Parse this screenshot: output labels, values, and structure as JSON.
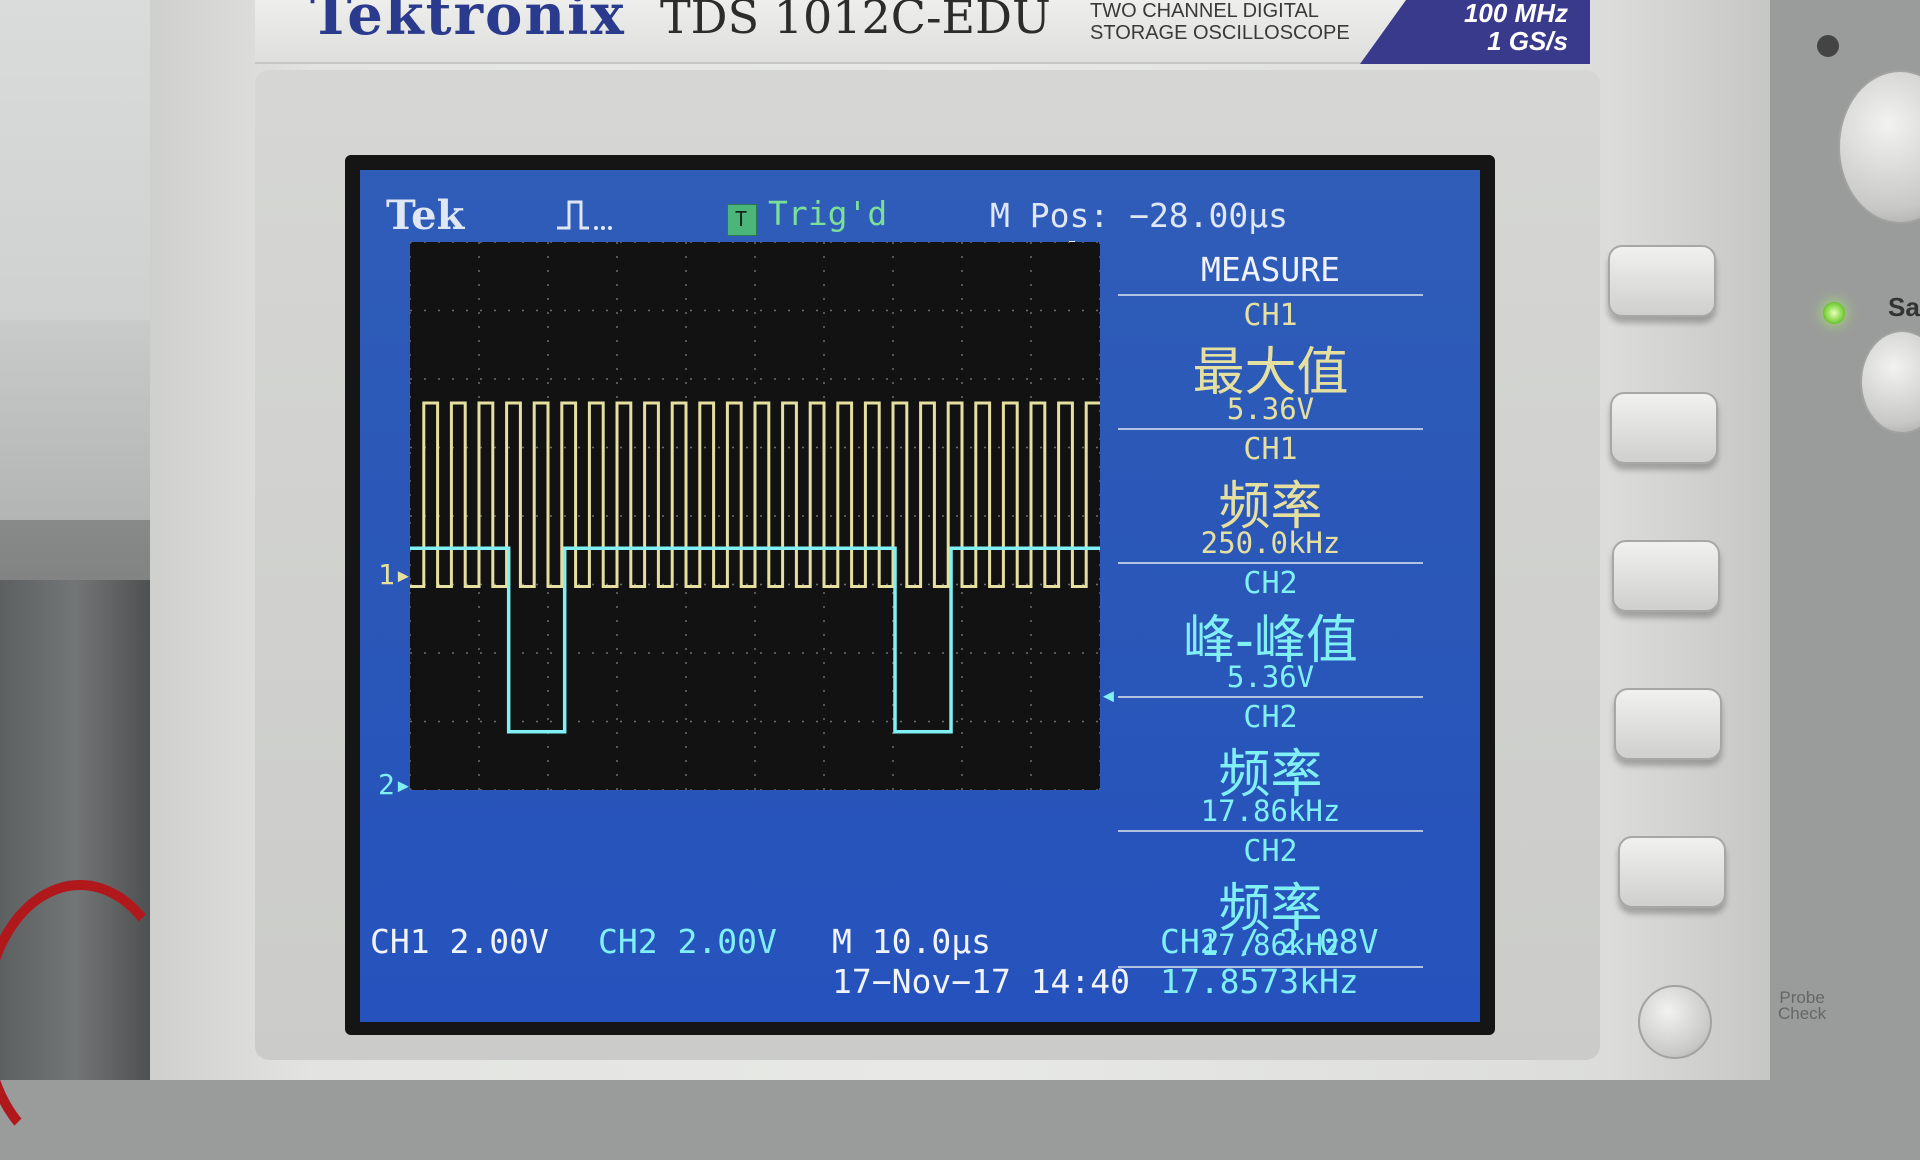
{
  "device": {
    "brand": "Tektronix",
    "model": "TDS 1012C-EDU",
    "description": "TWO CHANNEL DIGITAL\nSTORAGE OSCILLOSCOPE",
    "bandwidth": "100 MHz",
    "sample_rate": "1 GS/s",
    "side_label": "Sa",
    "probe_check_label": "Probe\nCheck"
  },
  "screen": {
    "logo": "Tek",
    "trigger_status": "Trig'd",
    "m_pos": "M Pos: −28.00µs",
    "ch1_marker": "1",
    "ch2_marker": "2",
    "menu": {
      "title": "MEASURE",
      "items": [
        {
          "channel": "CH1",
          "name": "最大值",
          "value": "5.36V"
        },
        {
          "channel": "CH1",
          "name": "频率",
          "value": "250.0kHz"
        },
        {
          "channel": "CH2",
          "name": "峰-峰值",
          "value": "5.36V"
        },
        {
          "channel": "CH2",
          "name": "频率",
          "value": "17.86kHz"
        },
        {
          "channel": "CH2",
          "name": "频率",
          "value": "17.86kHz"
        }
      ]
    },
    "status": {
      "ch1_scale": "CH1  2.00V",
      "ch2_scale": "CH2  2.00V",
      "timebase": "M 10.0µs",
      "datetime": "17−Nov−17 14:40",
      "trigger": "CH2 ∕ 2.08V",
      "trigger_freq": "17.8573kHz"
    },
    "colors": {
      "screen_bg": "#2a57b8",
      "ch1": "#e6e0a0",
      "ch2": "#80f0f5",
      "grid_bg": "#121212"
    }
  },
  "waveforms": {
    "ch1": {
      "type": "square",
      "frequency_khz": 250.0,
      "vmax_v": 5.36,
      "volts_per_div": 2.0
    },
    "ch2": {
      "type": "pulse",
      "frequency_khz": 17.86,
      "vpp_v": 5.36,
      "volts_per_div": 2.0,
      "trigger_level_v": 2.08
    },
    "timebase_us_per_div": 10.0,
    "m_pos_us": -28.0
  }
}
